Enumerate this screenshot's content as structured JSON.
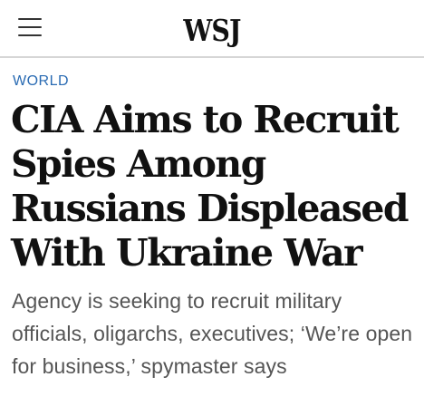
{
  "header": {
    "menu_icon": "hamburger-menu-icon",
    "logo_text": "WSJ"
  },
  "article": {
    "section": "WORLD",
    "headline": "CIA Aims to Recruit Spies Among Russians Displeased With Ukraine War",
    "dek": "Agency is seeking to recruit military officials, oligarchs, executives; ‘We’re open for business,’ spymaster says"
  },
  "colors": {
    "section_link": "#2a6bb3",
    "headline": "#111111",
    "dek": "#555555",
    "divider": "#d6d6d6"
  }
}
